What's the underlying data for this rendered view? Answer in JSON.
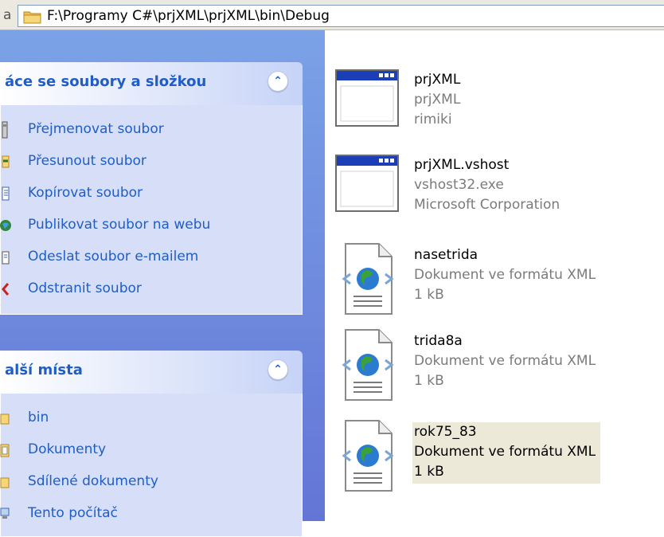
{
  "address_bar": {
    "prefix": "a",
    "path": "F:\\Programy C#\\prjXML\\prjXML\\bin\\Debug"
  },
  "task_pane": {
    "file_tasks": {
      "title": "áce se soubory a složkou",
      "items": [
        {
          "label": "Přejmenovat soubor",
          "icon": "rename-icon"
        },
        {
          "label": "Přesunout soubor",
          "icon": "move-icon"
        },
        {
          "label": "Kopírovat soubor",
          "icon": "copy-icon"
        },
        {
          "label": "Publikovat soubor na webu",
          "icon": "publish-web-icon"
        },
        {
          "label": "Odeslat soubor e-mailem",
          "icon": "email-icon"
        },
        {
          "label": "Odstranit soubor",
          "icon": "delete-icon"
        }
      ]
    },
    "other_places": {
      "title": "alší místa",
      "items": [
        {
          "label": "bin",
          "icon": "folder-icon"
        },
        {
          "label": "Dokumenty",
          "icon": "documents-icon"
        },
        {
          "label": "Sdílené dokumenty",
          "icon": "folder-icon"
        },
        {
          "label": "Tento počítač",
          "icon": "computer-icon"
        }
      ]
    }
  },
  "files": [
    {
      "name": "prjXML",
      "line2": "prjXML",
      "line3": "rimiki",
      "icon": "application-window-icon",
      "selected": false
    },
    {
      "name": "prjXML.vshost",
      "line2": "vshost32.exe",
      "line3": "Microsoft Corporation",
      "icon": "application-window-icon",
      "selected": false
    },
    {
      "name": "nasetrida",
      "line2": "Dokument ve formátu XML",
      "line3": "1 kB",
      "icon": "xml-document-icon",
      "selected": false
    },
    {
      "name": "trida8a",
      "line2": "Dokument ve formátu XML",
      "line3": "1 kB",
      "icon": "xml-document-icon",
      "selected": false
    },
    {
      "name": "rok75_83",
      "line2": "Dokument ve formátu XML",
      "line3": "1 kB",
      "icon": "xml-document-icon",
      "selected": true
    }
  ],
  "colors": {
    "task_link": "#215dc6",
    "pane_gradient_top": "#7ba2e7",
    "pane_gradient_bottom": "#6375d6",
    "selection_bg": "#ece9d8"
  }
}
